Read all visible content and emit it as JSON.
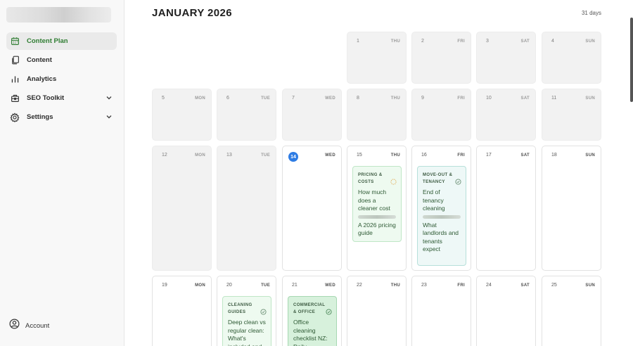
{
  "sidebar": {
    "items": [
      {
        "label": "Content Plan",
        "icon": "calendar-icon",
        "active": true
      },
      {
        "label": "Content",
        "icon": "documents-icon"
      },
      {
        "label": "Analytics",
        "icon": "bar-chart-icon"
      },
      {
        "label": "SEO Toolkit",
        "icon": "toolkit-icon",
        "expandable": true
      },
      {
        "label": "Settings",
        "icon": "gear-icon",
        "expandable": true
      }
    ],
    "account_label": "Account"
  },
  "header": {
    "title": "JANUARY 2026",
    "days_count": "31 days"
  },
  "colors": {
    "accent_green": "#2f7d32",
    "today_blue": "#2e7ce4"
  },
  "calendar": {
    "week1": [
      {
        "num": "1",
        "dow": "THU"
      },
      {
        "num": "2",
        "dow": "FRI"
      },
      {
        "num": "3",
        "dow": "SAT"
      },
      {
        "num": "4",
        "dow": "SUN"
      }
    ],
    "week2": [
      {
        "num": "5",
        "dow": "MON"
      },
      {
        "num": "6",
        "dow": "TUE"
      },
      {
        "num": "7",
        "dow": "WED"
      },
      {
        "num": "8",
        "dow": "THU"
      },
      {
        "num": "9",
        "dow": "FRI"
      },
      {
        "num": "10",
        "dow": "SAT"
      },
      {
        "num": "11",
        "dow": "SUN"
      }
    ],
    "week3": [
      {
        "num": "12",
        "dow": "MON"
      },
      {
        "num": "13",
        "dow": "TUE"
      },
      {
        "num": "14",
        "dow": "WED"
      },
      {
        "num": "15",
        "dow": "THU"
      },
      {
        "num": "16",
        "dow": "FRI"
      },
      {
        "num": "17",
        "dow": "SAT"
      },
      {
        "num": "18",
        "dow": "SUN"
      }
    ],
    "week4": [
      {
        "num": "19",
        "dow": "MON"
      },
      {
        "num": "20",
        "dow": "TUE"
      },
      {
        "num": "21",
        "dow": "WED"
      },
      {
        "num": "22",
        "dow": "THU"
      },
      {
        "num": "23",
        "dow": "FRI"
      },
      {
        "num": "24",
        "dow": "SAT"
      },
      {
        "num": "25",
        "dow": "SUN"
      }
    ]
  },
  "cards": {
    "jan15": {
      "category": "PRICING & COSTS",
      "title": "How much does a cleaner cost",
      "subtitle": "A 2026 pricing guide",
      "status_icon": "pending-circle-icon"
    },
    "jan16": {
      "category": "MOVE-OUT & TENANCY",
      "title": "End of tenancy cleaning",
      "subtitle": "What landlords and tenants expect",
      "status_icon": "check-circle-icon"
    },
    "jan20": {
      "category": "CLEANING GUIDES",
      "title": "Deep clean vs regular clean: What's included and",
      "status_icon": "check-circle-icon"
    },
    "jan21": {
      "category": "COMMERCIAL & OFFICE",
      "title": "Office cleaning checklist NZ: Daily",
      "status_icon": "check-circle-icon"
    }
  }
}
